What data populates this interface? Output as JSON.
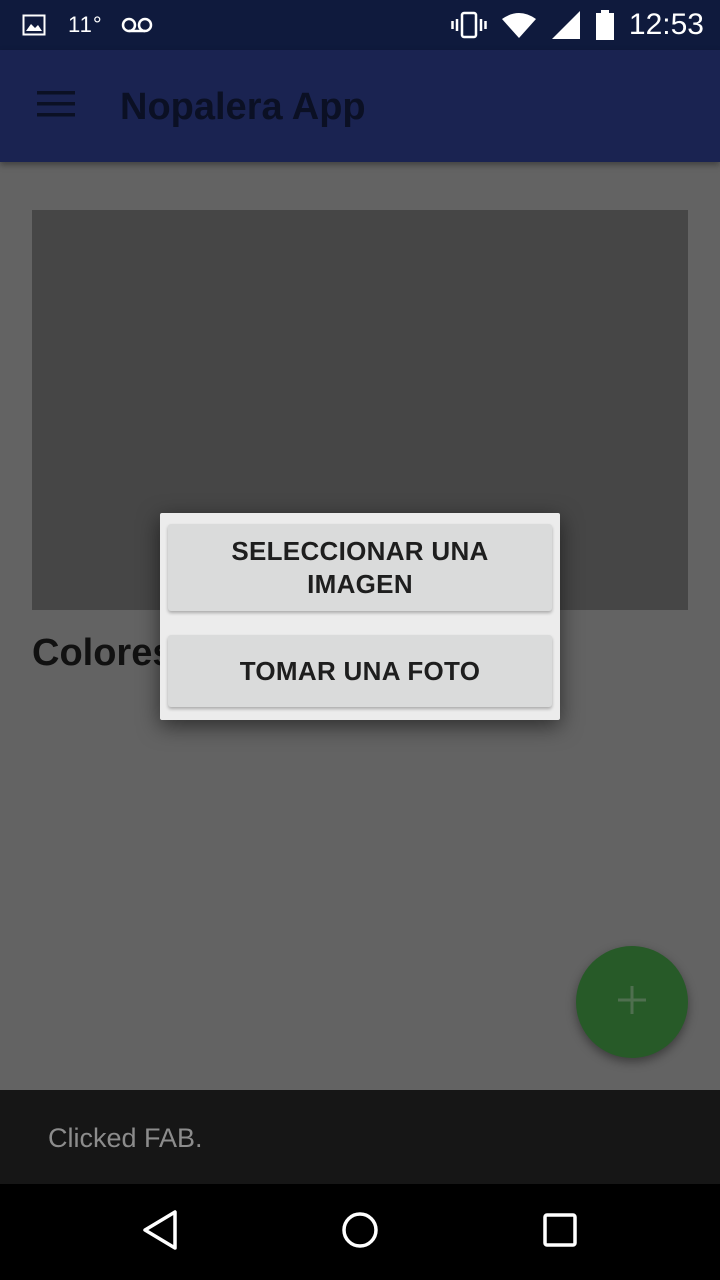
{
  "status_bar": {
    "temperature": "11°",
    "time": "12:53",
    "icons": [
      "image-icon",
      "voicemail-icon",
      "vibrate-icon",
      "wifi-icon",
      "signal-icon",
      "battery-icon"
    ]
  },
  "app_bar": {
    "title": "Nopalera App",
    "menu_icon": "hamburger-menu-icon"
  },
  "content": {
    "label": "Colores"
  },
  "dialog": {
    "select_image_label": "SELECCIONAR UNA IMAGEN",
    "take_photo_label": "TOMAR UNA FOTO"
  },
  "fab": {
    "icon": "plus-icon"
  },
  "snackbar": {
    "text": "Clicked FAB."
  },
  "nav_bar": {
    "icons": [
      "back-icon",
      "home-icon",
      "recents-icon"
    ]
  },
  "colors": {
    "status_bar": "#0f1a3d",
    "app_bar": "#1a2351",
    "dim_background": "#636363",
    "fab": "#275a28",
    "snackbar": "#161616"
  }
}
